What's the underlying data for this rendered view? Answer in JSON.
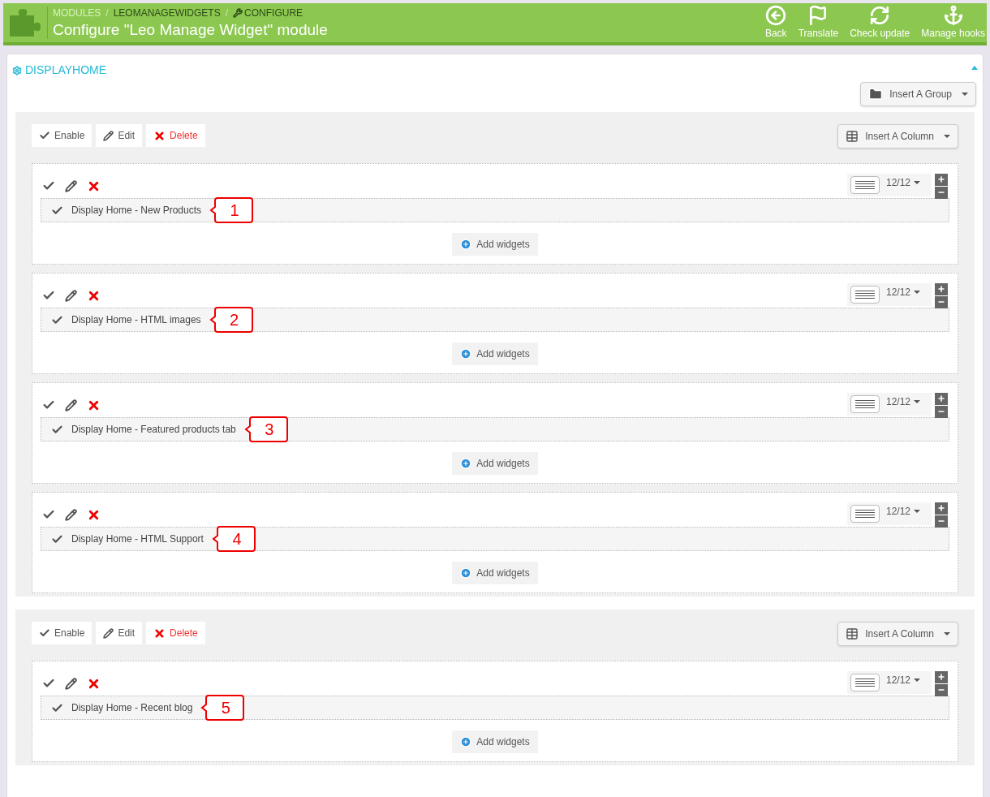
{
  "header": {
    "breadcrumb": [
      "MODULES",
      "LEOMANAGEWIDGETS",
      "CONFIGURE"
    ],
    "separator": "/",
    "title": "Configure \"Leo Manage Widget\" module",
    "actions": [
      "Back",
      "Translate",
      "Check update",
      "Manage hooks"
    ]
  },
  "panel": {
    "title": "DISPLAYHOME",
    "insert_group": "Insert A Group",
    "groups": [
      {
        "enable": "Enable",
        "edit": "Edit",
        "delete": "Delete",
        "insert_column": "Insert A Column",
        "columns": [
          {
            "width": "12/12",
            "widget": "Display Home - New Products",
            "callout": "1",
            "add": "Add widgets"
          },
          {
            "width": "12/12",
            "widget": "Display Home - HTML images",
            "callout": "2",
            "add": "Add widgets"
          },
          {
            "width": "12/12",
            "widget": "Display Home - Featured products tab",
            "callout": "3",
            "add": "Add widgets"
          },
          {
            "width": "12/12",
            "widget": "Display Home - HTML Support",
            "callout": "4",
            "add": "Add widgets"
          }
        ]
      },
      {
        "enable": "Enable",
        "edit": "Edit",
        "delete": "Delete",
        "insert_column": "Insert A Column",
        "columns": [
          {
            "width": "12/12",
            "widget": "Display Home - Recent blog",
            "callout": "5",
            "add": "Add widgets"
          }
        ]
      }
    ]
  }
}
